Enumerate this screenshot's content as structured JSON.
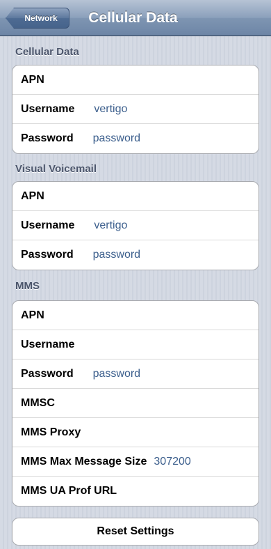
{
  "navbar": {
    "back_label": "Network",
    "title": "Cellular Data"
  },
  "sections": [
    {
      "header": "Cellular Data",
      "rows": [
        {
          "label": "APN",
          "value": ""
        },
        {
          "label": "Username",
          "value": "vertigo"
        },
        {
          "label": "Password",
          "value": "password"
        }
      ]
    },
    {
      "header": "Visual Voicemail",
      "rows": [
        {
          "label": "APN",
          "value": ""
        },
        {
          "label": "Username",
          "value": "vertigo"
        },
        {
          "label": "Password",
          "value": "password"
        }
      ]
    },
    {
      "header": "MMS",
      "rows": [
        {
          "label": "APN",
          "value": ""
        },
        {
          "label": "Username",
          "value": ""
        },
        {
          "label": "Password",
          "value": "password"
        },
        {
          "label": "MMSC",
          "value": ""
        },
        {
          "label": "MMS Proxy",
          "value": ""
        },
        {
          "label": "MMS Max Message Size",
          "value": "307200"
        },
        {
          "label": "MMS UA Prof URL",
          "value": ""
        }
      ]
    }
  ],
  "reset_label": "Reset Settings"
}
